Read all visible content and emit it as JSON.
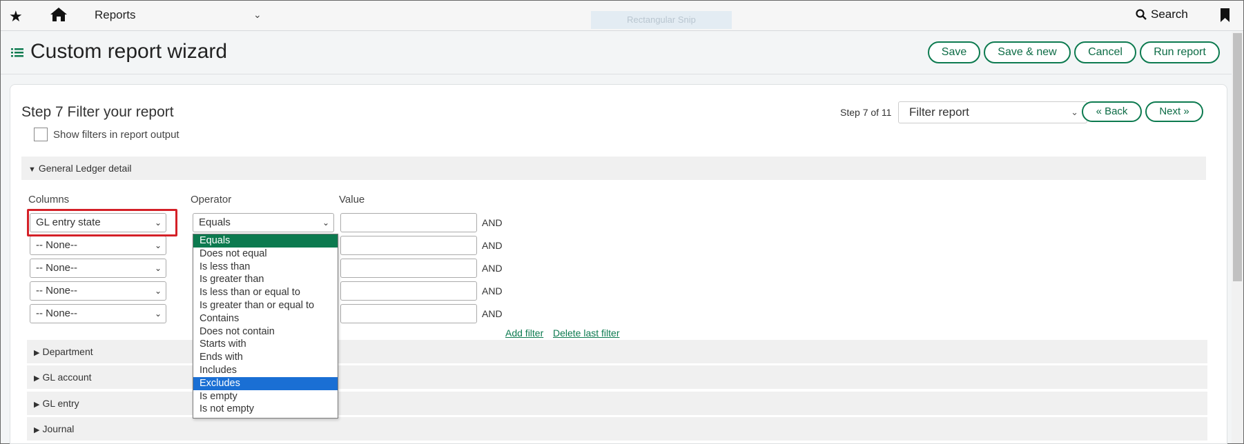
{
  "topnav": {
    "app_label": "Reports",
    "snip_label": "Rectangular Snip",
    "search_label": "Search"
  },
  "page": {
    "title": "Custom report wizard",
    "buttons": {
      "save": "Save",
      "save_new": "Save & new",
      "cancel": "Cancel",
      "run": "Run report"
    }
  },
  "wizard": {
    "step_title": "Step 7 Filter your report",
    "show_filters_label": "Show filters in report output",
    "show_filters_checked": false,
    "step_of": "Step 7 of 11",
    "step_select_value": "Filter report",
    "back_label": "« Back",
    "next_label": "Next »"
  },
  "filters": {
    "section_title": "General Ledger detail",
    "col_headers": {
      "columns": "Columns",
      "operator": "Operator",
      "value": "Value"
    },
    "rows": [
      {
        "column": "GL entry state",
        "operator": "Equals",
        "value": "",
        "join": "AND"
      },
      {
        "column": "-- None--",
        "operator": "",
        "value": "",
        "join": "AND"
      },
      {
        "column": "-- None--",
        "operator": "",
        "value": "",
        "join": "AND"
      },
      {
        "column": "-- None--",
        "operator": "",
        "value": "",
        "join": "AND"
      },
      {
        "column": "-- None--",
        "operator": "",
        "value": "",
        "join": "AND"
      }
    ],
    "add_filter": "Add filter",
    "delete_last_filter": "Delete last filter"
  },
  "operator_options": [
    "Equals",
    "Does not equal",
    "Is less than",
    "Is greater than",
    "Is less than or equal to",
    "Is greater than or equal to",
    "Contains",
    "Does not contain",
    "Starts with",
    "Ends with",
    "Includes",
    "Excludes",
    "Is empty",
    "Is not empty"
  ],
  "operator_selected": "Equals",
  "operator_highlighted": "Excludes",
  "collapsed_sections": [
    "Department",
    "GL account",
    "GL entry",
    "Journal"
  ],
  "colors": {
    "accent_green": "#0c7a4f",
    "highlight_blue": "#1a6fd4",
    "callout_red": "#d42027"
  }
}
